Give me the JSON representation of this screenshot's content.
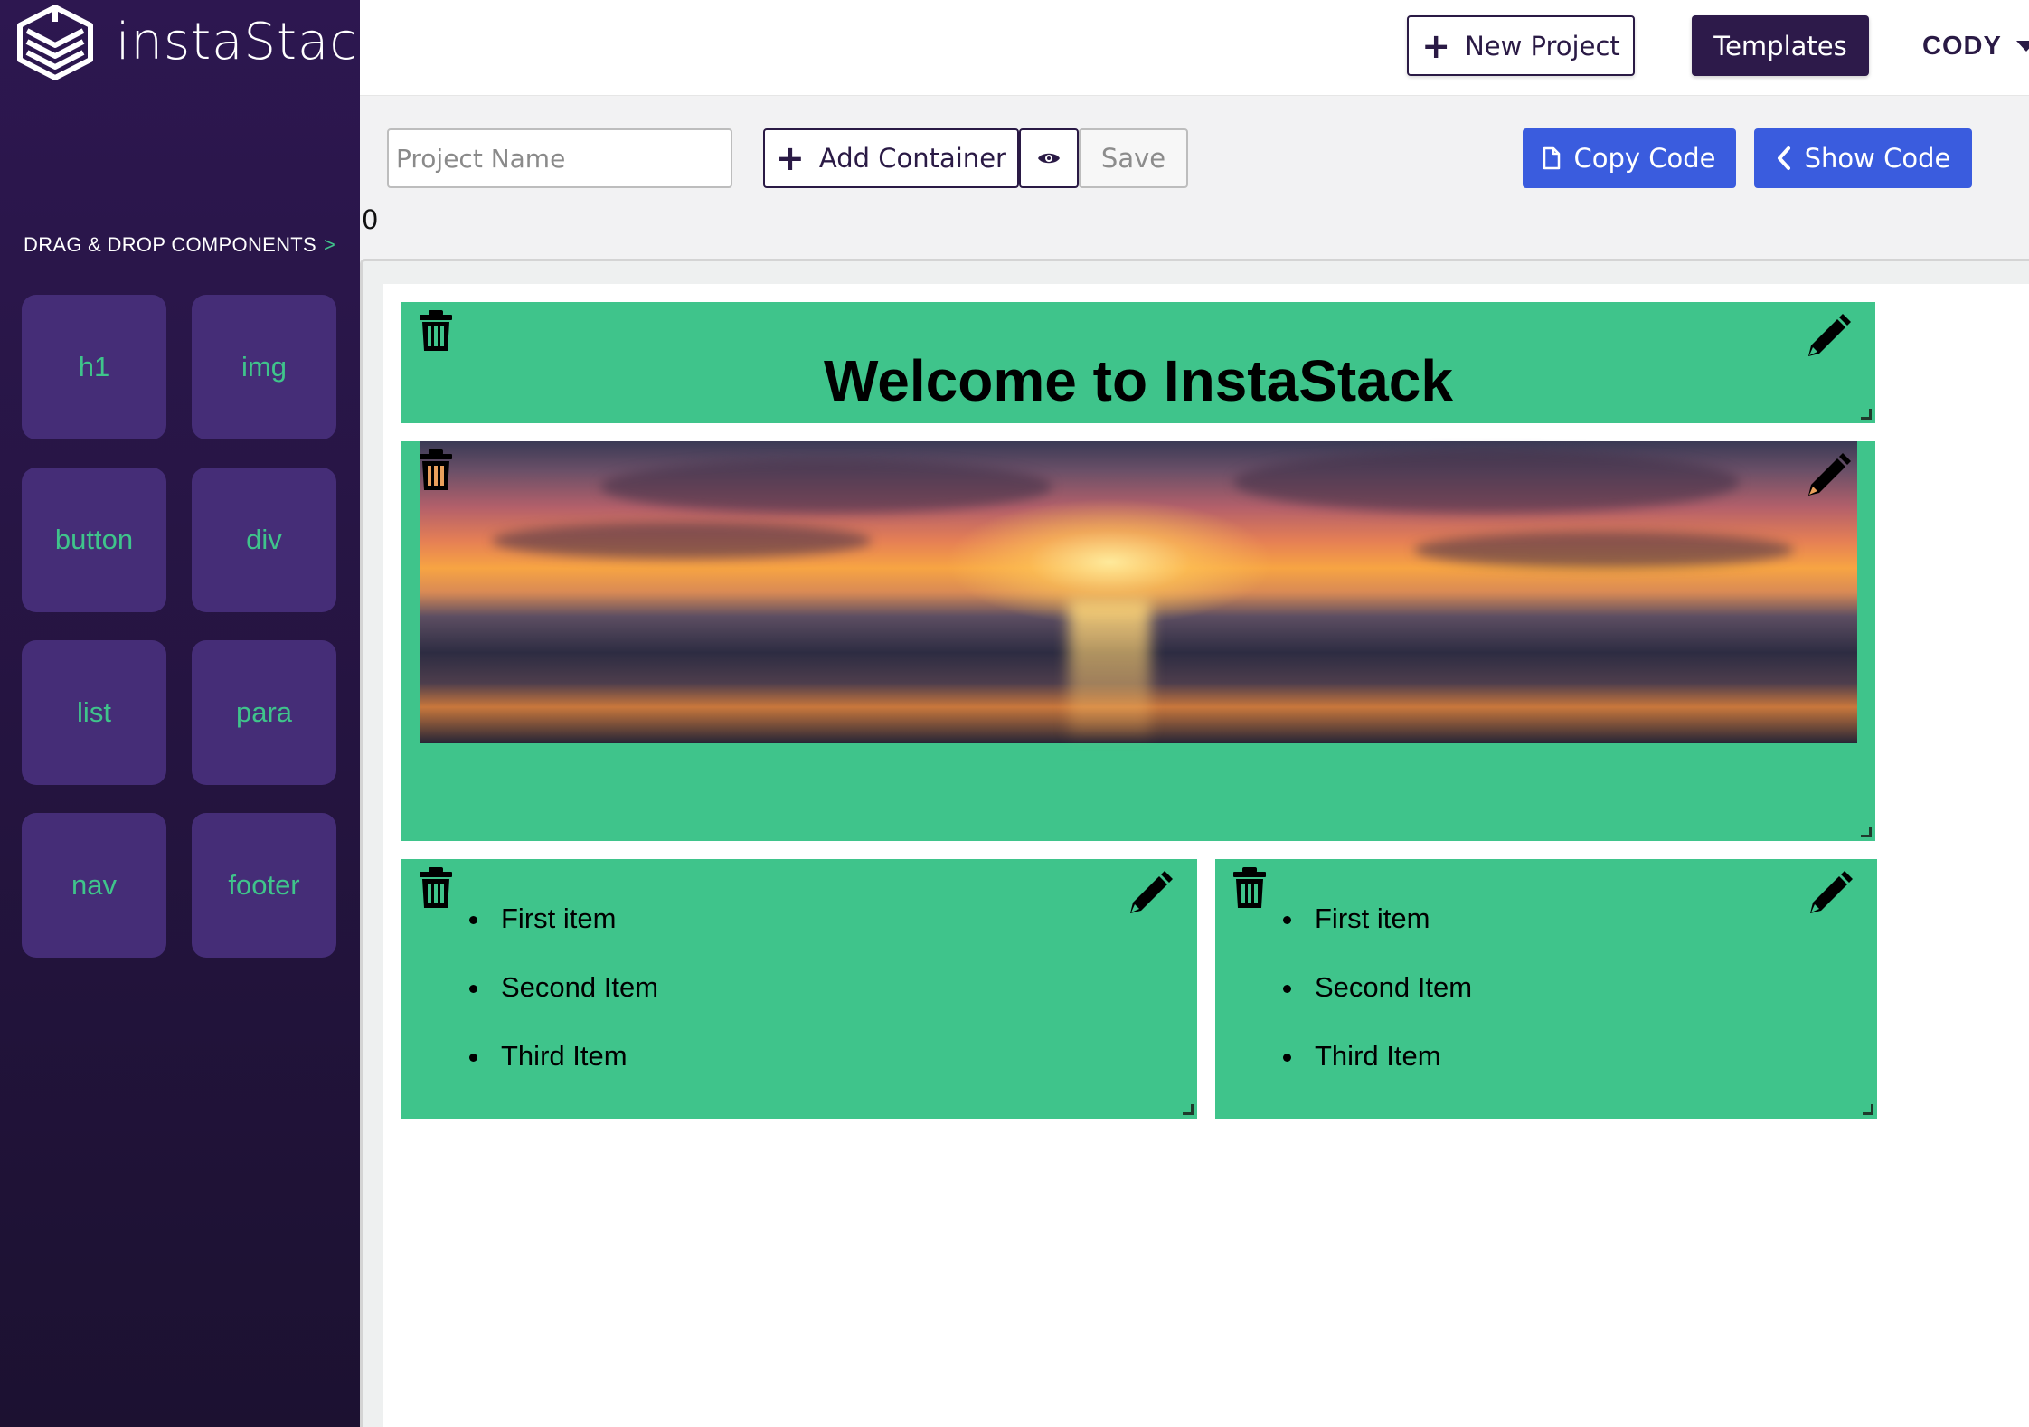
{
  "app": {
    "name": "instaStack"
  },
  "sidebar": {
    "title": "DRAG & DROP COMPONENTS",
    "title_arrow": ">",
    "components": [
      "h1",
      "img",
      "button",
      "div",
      "list",
      "para",
      "nav",
      "footer"
    ]
  },
  "topbar": {
    "new_project_label": "New Project",
    "templates_label": "Templates",
    "user_name": "CODY"
  },
  "toolbar": {
    "project_name_placeholder": "Project Name",
    "add_container_label": "Add Container",
    "save_label": "Save",
    "copy_code_label": "Copy Code",
    "show_code_label": "Show Code",
    "counter": "0"
  },
  "canvas": {
    "heading_text": "Welcome to InstaStack",
    "list_left": [
      "First item",
      "Second Item",
      "Third Item"
    ],
    "list_right": [
      "First item",
      "Second Item",
      "Third Item"
    ],
    "block_color": "#3fc48b"
  },
  "colors": {
    "sidebar_bg": "#2d1750",
    "component_bg": "#452d77",
    "accent_green": "#3fc48b",
    "primary_blue": "#3a5cde",
    "dark_purple": "#2d1a4a"
  }
}
